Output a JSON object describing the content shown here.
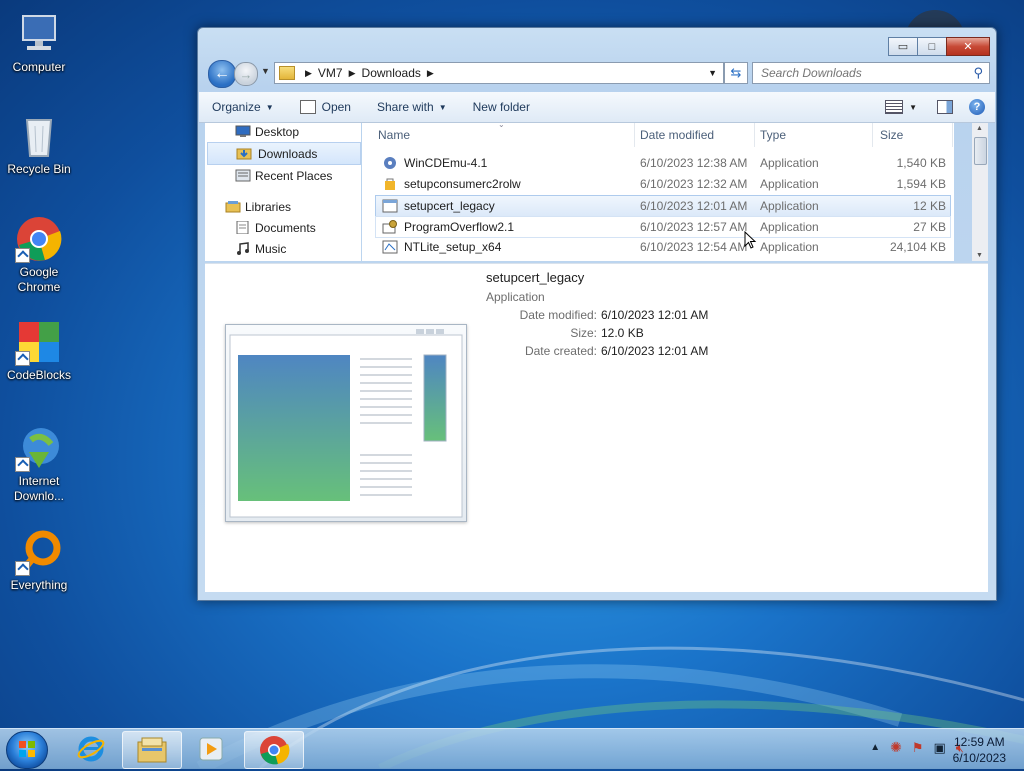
{
  "desktop": {
    "icons": [
      {
        "label": "Computer",
        "icon": "computer-icon"
      },
      {
        "label": "Recycle Bin",
        "icon": "recycle-bin-icon"
      },
      {
        "label": "Google Chrome",
        "icon": "chrome-icon"
      },
      {
        "label": "CodeBlocks",
        "icon": "codeblocks-icon"
      },
      {
        "label": "Internet Downlo...",
        "icon": "idm-icon"
      },
      {
        "label": "Everything",
        "icon": "everything-icon"
      }
    ]
  },
  "window": {
    "caption_buttons": {
      "minimize": "▭",
      "maximize": "□",
      "close": "✕"
    },
    "address": {
      "segments": [
        "VM7",
        "Downloads"
      ]
    },
    "search": {
      "placeholder": "Search Downloads"
    },
    "toolbar": {
      "organize": "Organize",
      "open": "Open",
      "share_with": "Share with",
      "new_folder": "New folder",
      "help": "?"
    },
    "nav": {
      "items": [
        {
          "label": "Desktop",
          "icon": "desktop-icon"
        },
        {
          "label": "Downloads",
          "icon": "downloads-icon",
          "selected": true
        },
        {
          "label": "Recent Places",
          "icon": "recent-places-icon"
        },
        {
          "label": "Libraries",
          "icon": "libraries-icon"
        },
        {
          "label": "Documents",
          "icon": "documents-icon"
        },
        {
          "label": "Music",
          "icon": "music-icon"
        }
      ]
    },
    "columns": {
      "name": "Name",
      "date": "Date modified",
      "type": "Type",
      "size": "Size"
    },
    "files": [
      {
        "name": "WinCDEmu-4.1",
        "date": "6/10/2023 12:38 AM",
        "type": "Application",
        "size": "1,540 KB",
        "icon": "installer-icon"
      },
      {
        "name": "setupconsumerc2rolw",
        "date": "6/10/2023 12:32 AM",
        "type": "Application",
        "size": "1,594 KB",
        "icon": "office-setup-icon"
      },
      {
        "name": "setupcert_legacy",
        "date": "6/10/2023 12:01 AM",
        "type": "Application",
        "size": "12 KB",
        "icon": "app-window-icon",
        "selected": true
      },
      {
        "name": "ProgramOverflow2.1",
        "date": "6/10/2023 12:57 AM",
        "type": "Application",
        "size": "27 KB",
        "icon": "gear-app-icon",
        "hover": true
      },
      {
        "name": "NTLite_setup_x64",
        "date": "6/10/2023 12:54 AM",
        "type": "Application",
        "size": "24,104 KB",
        "icon": "setup-icon"
      }
    ],
    "preview": {
      "title": "setupcert_legacy",
      "subtitle": "Application",
      "properties": [
        {
          "key": "Date modified:",
          "value": "6/10/2023 12:01 AM"
        },
        {
          "key": "Size:",
          "value": "12.0 KB"
        },
        {
          "key": "Date created:",
          "value": "6/10/2023 12:01 AM"
        }
      ]
    }
  },
  "taskbar": {
    "clock": {
      "time": "12:59 AM",
      "date": "6/10/2023"
    },
    "apps": [
      "internet-explorer-icon",
      "file-explorer-icon",
      "media-player-icon",
      "chrome-icon"
    ]
  },
  "colors": {
    "accent": "#1a73c9",
    "selection": "#dce9f9",
    "close": "#c74a36"
  }
}
